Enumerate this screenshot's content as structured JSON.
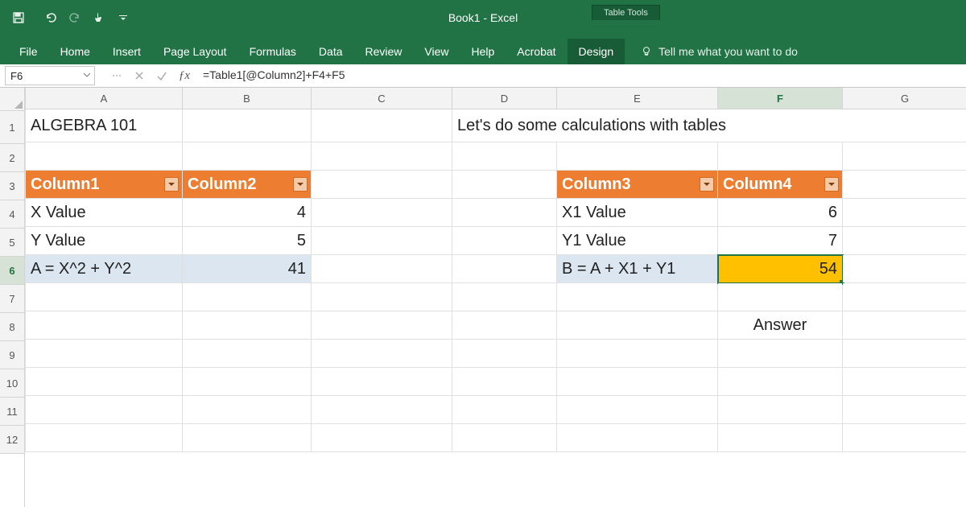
{
  "app": {
    "title": "Book1  -  Excel",
    "table_tools_label": "Table Tools"
  },
  "ribbon": {
    "tabs": [
      "File",
      "Home",
      "Insert",
      "Page Layout",
      "Formulas",
      "Data",
      "Review",
      "View",
      "Help",
      "Acrobat",
      "Design"
    ],
    "tell_me": "Tell me what you want to do"
  },
  "formula_bar": {
    "name_box": "F6",
    "formula": "=Table1[@Column2]+F4+F5"
  },
  "columns": [
    "A",
    "B",
    "C",
    "D",
    "E",
    "F",
    "G"
  ],
  "rows": [
    "1",
    "2",
    "3",
    "4",
    "5",
    "6",
    "7",
    "8",
    "9",
    "10",
    "11",
    "12"
  ],
  "selected": {
    "col": "F",
    "row": "6"
  },
  "cells": {
    "A1": "ALGEBRA 101",
    "D1": "Let's do some calculations with tables",
    "A3": "Column1",
    "B3": "Column2",
    "A4": "X Value",
    "B4": "4",
    "A5": "Y Value",
    "B5": "5",
    "A6": "A = X^2 + Y^2",
    "B6": "41",
    "E3": "Column3",
    "F3": "Column4",
    "E4": "X1 Value",
    "F4": "6",
    "E5": "Y1 Value",
    "F5": "7",
    "E6": "B = A + X1 + Y1",
    "F6": "54",
    "F8": "Answer"
  }
}
